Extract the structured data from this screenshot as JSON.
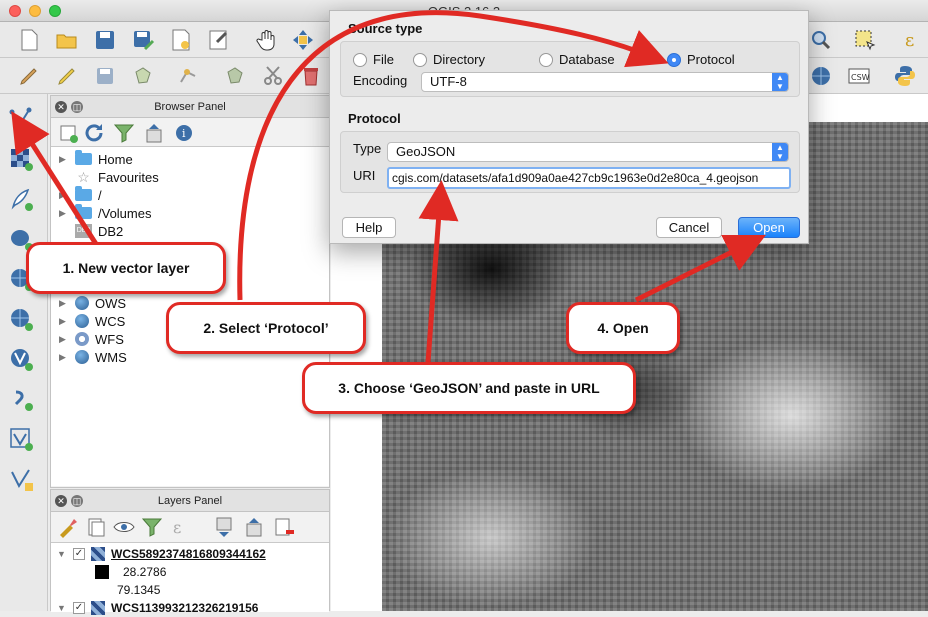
{
  "window": {
    "title": "QGIS 2.16.2"
  },
  "browser_panel": {
    "title": "Browser Panel",
    "items": [
      {
        "label": "Home",
        "icon": "folder-icon",
        "expandable": true
      },
      {
        "label": "Favourites",
        "icon": "star-icon",
        "expandable": false
      },
      {
        "label": "/",
        "icon": "folder-icon",
        "expandable": true
      },
      {
        "label": "/Volumes",
        "icon": "folder-icon",
        "expandable": true
      },
      {
        "label": "DB2",
        "icon": "db2-icon",
        "expandable": false
      },
      {
        "label": "OWS",
        "icon": "globe-icon",
        "expandable": true
      },
      {
        "label": "WCS",
        "icon": "globe-icon",
        "expandable": true
      },
      {
        "label": "WFS",
        "icon": "wfs-icon",
        "expandable": true
      },
      {
        "label": "WMS",
        "icon": "globe-icon",
        "expandable": true
      }
    ]
  },
  "layers_panel": {
    "title": "Layers Panel",
    "layers": [
      {
        "name": "WCS5892374816809344162",
        "checked": true,
        "legend": [
          "28.2786",
          "79.1345"
        ]
      },
      {
        "name": "WCS113993212326219156",
        "checked": true
      }
    ]
  },
  "dialog": {
    "source_type": {
      "title": "Source type",
      "options": [
        "File",
        "Directory",
        "Database",
        "Protocol"
      ],
      "selected": "Protocol",
      "encoding_label": "Encoding",
      "encoding_value": "UTF-8"
    },
    "protocol": {
      "title": "Protocol",
      "type_label": "Type",
      "type_value": "GeoJSON",
      "uri_label": "URI",
      "uri_value": "cgis.com/datasets/afa1d909a0ae427cb9c1963e0d2e80ca_4.geojson"
    },
    "buttons": {
      "help": "Help",
      "cancel": "Cancel",
      "open": "Open"
    }
  },
  "callouts": {
    "step1": "1. New vector layer",
    "step2": "2. Select ‘Protocol’",
    "step3": "3. Choose ‘GeoJSON’ and paste in URL",
    "step4": "4. Open"
  },
  "colors": {
    "callout_red": "#e02a24",
    "accent_blue": "#3f88f5"
  }
}
